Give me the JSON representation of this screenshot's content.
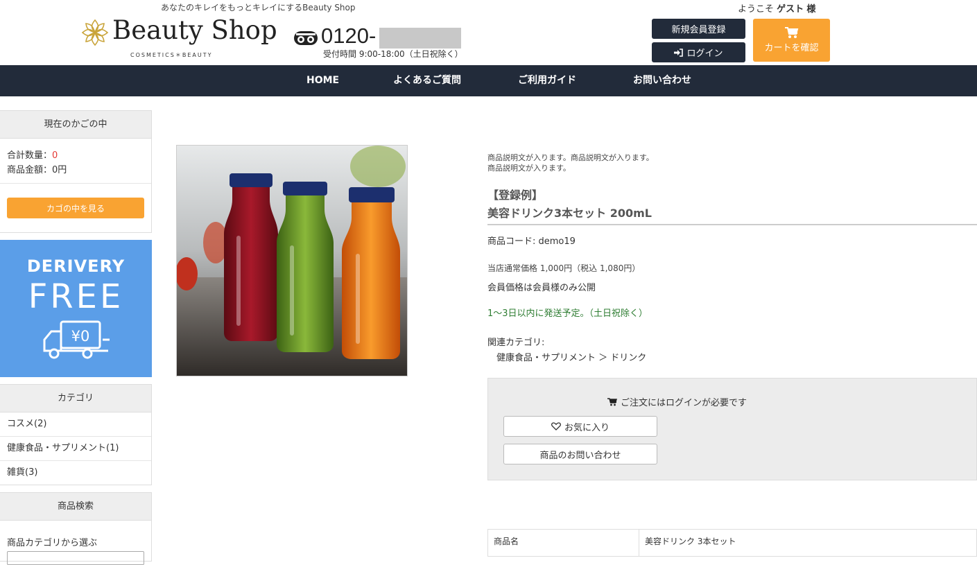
{
  "header": {
    "tagline": "あなたのキレイをもっとキレイにするBeauty Shop",
    "logo_text": "Beauty Shop",
    "logo_sub": "COSMETICS＊BEAUTY",
    "phone_number": "0120-",
    "phone_hours": "受付時間 9:00-18:00（土日祝除く）",
    "welcome_prefix": "ようこそ",
    "welcome_user": "ゲスト",
    "welcome_suffix": "様",
    "register_label": "新規会員登録",
    "login_label": "ログイン",
    "cart_label": "カートを確認"
  },
  "nav": {
    "items": [
      {
        "label": "HOME"
      },
      {
        "label": "よくあるご質問"
      },
      {
        "label": "ご利用ガイド"
      },
      {
        "label": "お問い合わせ"
      }
    ]
  },
  "sidebar": {
    "cart": {
      "title": "現在のかごの中",
      "qty_label": "合計数量：",
      "qty_value": "0",
      "amount_label": "商品金額：",
      "amount_value": "0円",
      "view_button": "カゴの中を見る"
    },
    "banner": {
      "line1": "DERIVERY",
      "line2": "FREE",
      "truck_text": "¥0"
    },
    "categories": {
      "title": "カテゴリ",
      "items": [
        {
          "label": "コスメ(2)"
        },
        {
          "label": "健康食品・サプリメント(1)"
        },
        {
          "label": "雑貨(3)"
        }
      ]
    },
    "search": {
      "title": "商品検索",
      "category_label": "商品カテゴリから選ぶ"
    }
  },
  "product": {
    "description_line1": "商品説明文が入ります。商品説明文が入ります。",
    "description_line2": "商品説明文が入ります。",
    "register_example": "【登録例】",
    "name": "美容ドリンク3本セット 200mL",
    "code": "商品コード: demo19",
    "price": "当店通常価格 1,000円（税込 1,080円）",
    "member_price": "会員価格は会員様のみ公開",
    "shipping": "1〜3日以内に発送予定。（土日祝除く）",
    "related_label": "関連カテゴリ:",
    "related_path": "健康食品・サプリメント ＞ ドリンク",
    "order": {
      "login_required": "ご注文にはログインが必要です",
      "favorite_label": "お気に入り",
      "inquiry_label": "商品のお問い合わせ"
    },
    "spec": {
      "header": "商品名",
      "value": "美容ドリンク 3本セット"
    }
  },
  "colors": {
    "navy": "#222b3a",
    "orange": "#f9a332",
    "banner_blue": "#5b9ee8",
    "ship_green": "#2e7d32"
  }
}
